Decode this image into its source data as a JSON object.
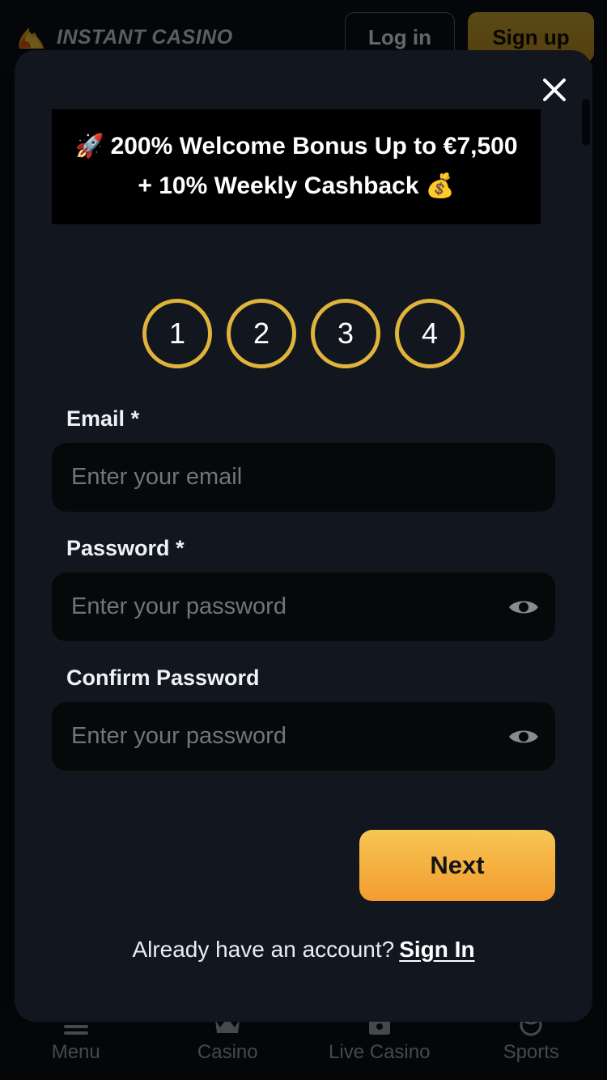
{
  "colors": {
    "page_bg": "#0a0c11",
    "modal_bg": "#12161e",
    "accent_gold": "#e0b33c",
    "button_gradient_top": "#f7c654",
    "button_gradient_bottom": "#f39c2e",
    "banner_bg": "#000000",
    "input_bg": "#070809",
    "text_primary": "#ffffff",
    "text_muted": "#9aa0ab",
    "placeholder": "#70747c"
  },
  "header": {
    "brand_name": "INSTANT CASINO",
    "logo_icon": "flame-logo-icon",
    "login_label": "Log in",
    "signup_label": "Sign up"
  },
  "modal": {
    "close_icon": "close-icon",
    "banner": {
      "leading_emoji": "🚀",
      "line1": "200% Welcome Bonus Up to €7,500",
      "line2": "+ 10% Weekly Cashback",
      "trailing_emoji": "💰"
    },
    "steps": [
      {
        "number": "1",
        "state": "active"
      },
      {
        "number": "2",
        "state": "inactive"
      },
      {
        "number": "3",
        "state": "inactive"
      },
      {
        "number": "4",
        "state": "inactive"
      }
    ],
    "form": {
      "email": {
        "label": "Email",
        "required_mark": "*",
        "placeholder": "Enter your email",
        "value": ""
      },
      "password": {
        "label": "Password",
        "required_mark": "*",
        "placeholder": "Enter your password",
        "value": "",
        "toggle_icon": "eye-icon"
      },
      "confirm_password": {
        "label": "Confirm Password",
        "required_mark": "",
        "placeholder": "Enter your password",
        "value": "",
        "toggle_icon": "eye-icon"
      },
      "submit_label": "Next"
    },
    "footer": {
      "prompt": "Already have an account?",
      "link_label": "Sign In"
    }
  },
  "bottom_nav": [
    {
      "label": "Menu",
      "icon": "hamburger-menu-icon"
    },
    {
      "label": "Casino",
      "icon": "crown-icon"
    },
    {
      "label": "Live Casino",
      "icon": "live-casino-icon"
    },
    {
      "label": "Sports",
      "icon": "sports-ball-icon"
    }
  ]
}
